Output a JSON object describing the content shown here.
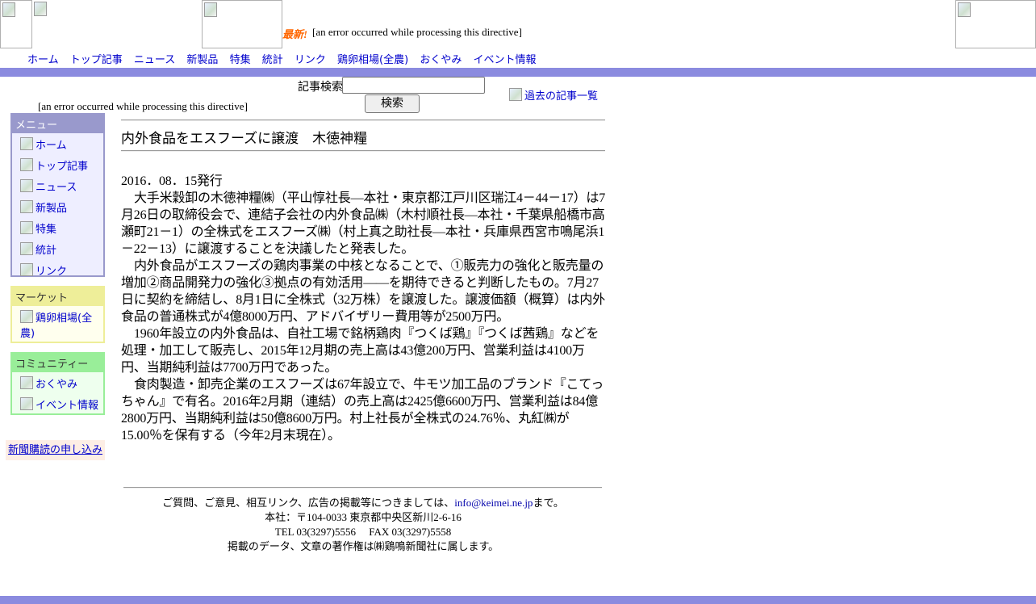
{
  "header": {
    "latest_label": "最新!",
    "error_text": "[an error occurred while processing this directive]",
    "nav": [
      "ホーム",
      "トップ記事",
      "ニュース",
      "新製品",
      "特集",
      "統計",
      "リンク",
      "鶏卵相場(全農)",
      "おくやみ",
      "イベント情報"
    ]
  },
  "search": {
    "label": "記事検索",
    "value": "",
    "button": "検索",
    "past_articles": "過去の記事一覧"
  },
  "left_error": "[an error occurred while processing this directive]",
  "sidebar": {
    "menu": {
      "title": "メニュー",
      "items": [
        "ホーム",
        "トップ記事",
        "ニュース",
        "新製品",
        "特集",
        "統計",
        "リンク"
      ]
    },
    "market": {
      "title": "マーケット",
      "items": [
        "鶏卵相場(全農)"
      ]
    },
    "community": {
      "title": "コミュニティー",
      "items": [
        "おくやみ",
        "イベント情報"
      ]
    },
    "subscribe": "新聞購読の申し込み"
  },
  "article": {
    "title": "内外食品をエスフーズに譲渡　木徳神糧",
    "date": "2016．08．15発行",
    "paragraphs": [
      "大手米穀卸の木徳神糧㈱（平山惇社長―本社・東京都江戸川区瑞江4－44－17）は7月26日の取締役会で、連結子会社の内外食品㈱（木村順社長―本社・千葉県船橋市高瀬町21－1）の全株式をエスフーズ㈱（村上真之助社長―本社・兵庫県西宮市鳴尾浜1－22－13）に譲渡することを決議したと発表した。",
      "内外食品がエスフーズの鶏肉事業の中核となることで、①販売力の強化と販売量の増加②商品開発力の強化③拠点の有効活用――を期待できると判断したもの。7月27日に契約を締結し、8月1日に全株式（32万株）を譲渡した。譲渡価額（概算）は内外食品の普通株式が4億8000万円、アドバイザリー費用等が2500万円。",
      "1960年設立の内外食品は、自社工場で銘柄鶏肉『つくば鶏』『つくば茜鶏』などを処理・加工して販売し、2015年12月期の売上高は43億200万円、営業利益は4100万円、当期純利益は7700万円であった。",
      "食肉製造・卸売企業のエスフーズは67年設立で、牛モツ加工品のブランド『こてっちゃん』で有名。2016年2月期（連結）の売上高は2425億6600万円、営業利益は84億2800万円、当期純利益は50億8600万円。村上社長が全株式の24.76％、丸紅㈱が15.00％を保有する（今年2月末現在）。"
    ]
  },
  "footer": {
    "line1_pre": "ご質問、ご意見、相互リンク、広告の掲載等につきましては、",
    "email": "info@keimei.ne.jp",
    "line1_post": "まで。",
    "line2": "本社：〒104-0033 東京都中央区新川2-6-16",
    "line3": "TEL 03(3297)5556　 FAX 03(3297)5558",
    "line4": "掲載のデータ、文章の著作権は㈱鶏鳴新聞社に属します。"
  }
}
